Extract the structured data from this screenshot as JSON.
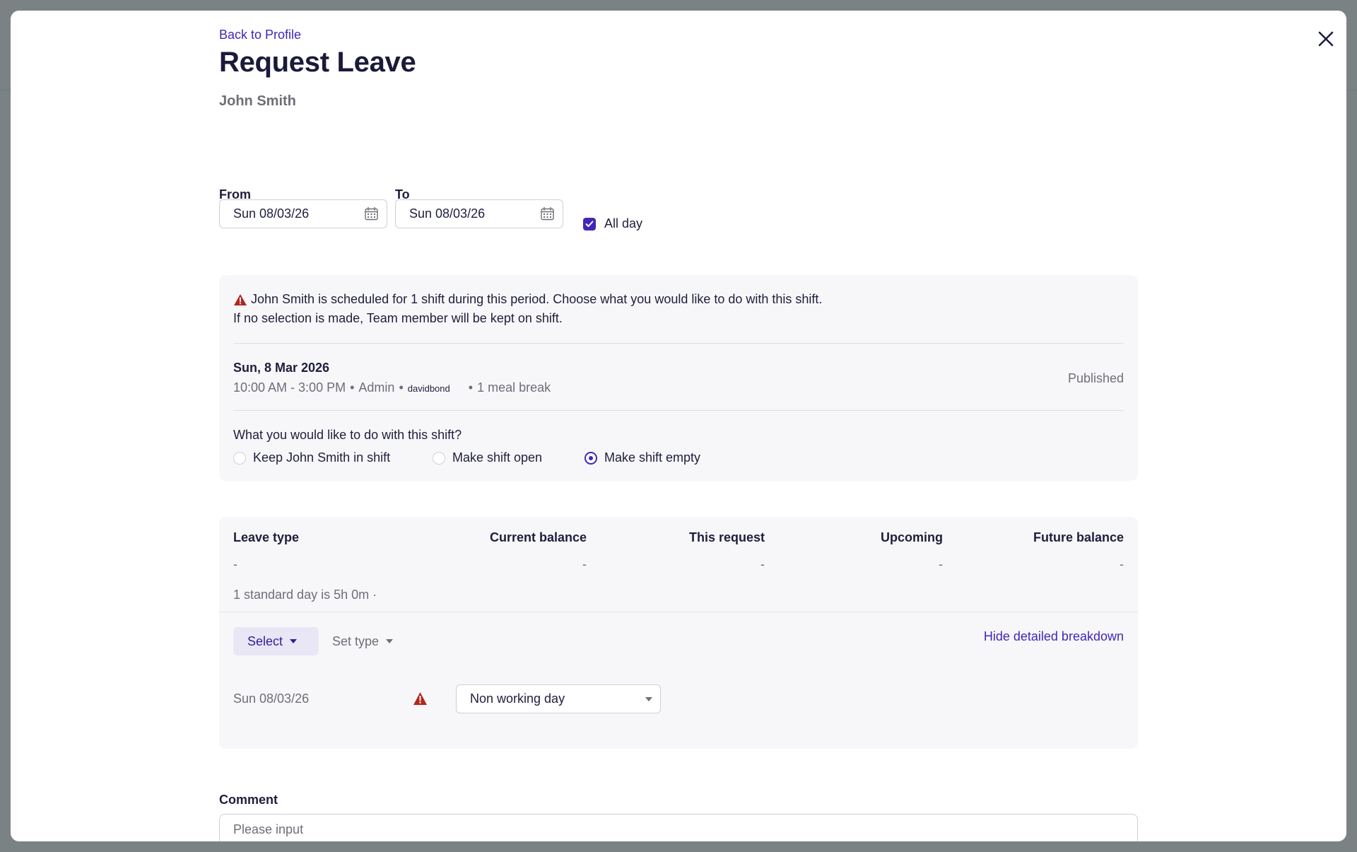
{
  "modal": {
    "back_link": "Back to Profile",
    "title": "Request Leave",
    "employee_name": "John Smith"
  },
  "dates": {
    "from_label": "From",
    "from_value": "Sun 08/03/26",
    "to_label": "To",
    "to_value": "Sun 08/03/26",
    "all_day_label": "All day",
    "all_day_checked": true
  },
  "conflict": {
    "message_line1": "John Smith is scheduled for 1 shift during this period. Choose what you would like to do with this shift.",
    "message_line2": "If no selection is made, Team member will be kept on shift.",
    "shift": {
      "date": "Sun, 8 Mar 2026",
      "time": "10:00 AM - 3:00 PM",
      "role": "Admin",
      "user": "davidbond",
      "breaks": "1 meal break",
      "status": "Published"
    },
    "question": "What you would like to do with this shift?",
    "options": [
      {
        "label": "Keep John Smith in shift",
        "selected": false
      },
      {
        "label": "Make shift open",
        "selected": false
      },
      {
        "label": "Make shift empty",
        "selected": true
      }
    ]
  },
  "balance": {
    "headers": [
      "Leave type",
      "Current balance",
      "This request",
      "Upcoming",
      "Future balance"
    ],
    "values": [
      "-",
      "-",
      "-",
      "-",
      "-"
    ],
    "standard_day": "1 standard day is 5h 0m ·",
    "select_label": "Select",
    "set_type_label": "Set type",
    "hide_breakdown": "Hide detailed breakdown",
    "rows": [
      {
        "date": "Sun 08/03/26",
        "day_type": "Non working day"
      }
    ]
  },
  "comment": {
    "label": "Comment",
    "placeholder": "Please input"
  },
  "colors": {
    "accent": "#4326b8",
    "warning": "#b3261e",
    "panel_bg": "#f7f7f9"
  },
  "icons": {
    "close": "close-icon",
    "calendar": "calendar-icon",
    "warning": "warning-icon",
    "checkbox": "check-icon"
  }
}
